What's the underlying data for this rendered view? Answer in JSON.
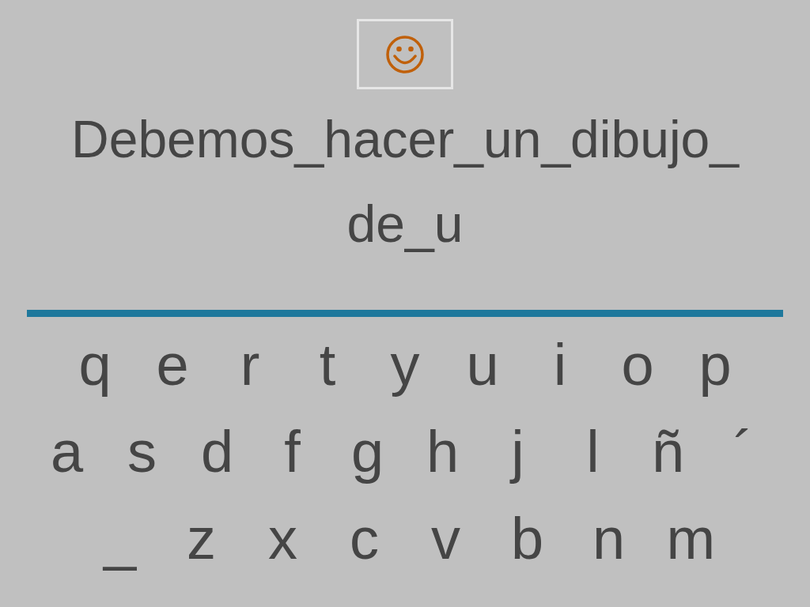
{
  "phrase_lines": [
    "Debemos_hacer_un_dibujo_",
    "de_u"
  ],
  "keyboard_rows": [
    [
      "q",
      "e",
      "r",
      "t",
      "y",
      "u",
      "i",
      "o",
      "p"
    ],
    [
      "a",
      "s",
      "d",
      "f",
      "g",
      "h",
      "j",
      "l",
      "ñ",
      "´"
    ],
    [
      "_",
      "z",
      "x",
      "c",
      "v",
      "b",
      "n",
      "m"
    ]
  ]
}
